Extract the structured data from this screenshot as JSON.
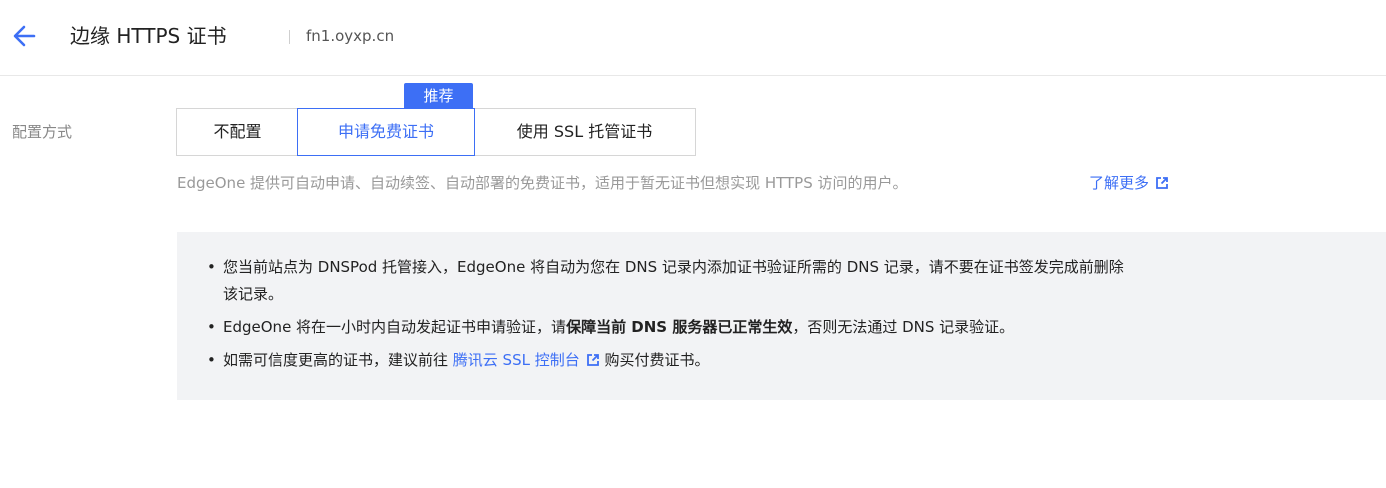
{
  "header": {
    "title": "边缘 HTTPS 证书",
    "domain": "fn1.oyxp.cn"
  },
  "config": {
    "label": "配置方式",
    "badge": "推荐",
    "options": [
      {
        "label": "不配置",
        "selected": false
      },
      {
        "label": "申请免费证书",
        "selected": true
      },
      {
        "label": "使用 SSL 托管证书",
        "selected": false
      }
    ],
    "description": "EdgeOne 提供可自动申请、自动续签、自动部署的免费证书，适用于暂无证书但想实现 HTTPS 访问的用户。",
    "learn_more": "了解更多"
  },
  "notice": {
    "bullet": "•",
    "item1_line1": "您当前站点为 DNSPod 托管接入，EdgeOne 将自动为您在 DNS 记录内添加证书验证所需的 DNS 记录，请不要在证书签发完成前删除",
    "item1_line2": "该记录。",
    "item2_prefix": "EdgeOne 将在一小时内自动发起证书申请验证，请",
    "item2_bold": "保障当前 DNS 服务器已正常生效",
    "item2_suffix": "，否则无法通过 DNS 记录验证。",
    "item3_prefix": "如需可信度更高的证书，建议前往 ",
    "item3_link": "腾讯云 SSL 控制台",
    "item3_suffix": " 购买付费证书。"
  },
  "colors": {
    "accent": "#3d6ff5",
    "notice_bg": "#f2f3f5",
    "muted_text": "#999999"
  },
  "icons": {
    "back": "arrow-left-icon",
    "external": "external-link-icon"
  }
}
